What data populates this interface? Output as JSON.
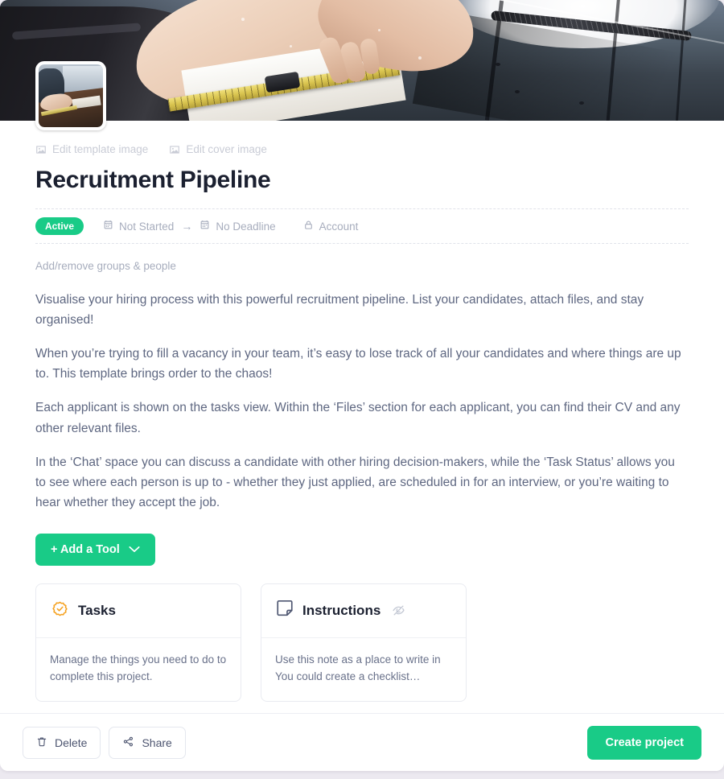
{
  "cover": {
    "alt": "Hands measuring a plank with a tape measure on a dark wooden workbench",
    "thumbnail_alt": "Person working at a workbench by a window"
  },
  "image_actions": [
    {
      "label": "Edit template image",
      "icon": "image-icon"
    },
    {
      "label": "Edit cover image",
      "icon": "image-icon"
    }
  ],
  "title": "Recruitment Pipeline",
  "meta": {
    "status_badge": "Active",
    "start_date": "Not Started",
    "arrow": "→",
    "due_date": "No Deadline",
    "visibility": "Account",
    "start_icon": "calendar-icon",
    "due_icon": "calendar-icon",
    "visibility_icon": "lock-icon"
  },
  "groups_link": "Add/remove groups & people",
  "description": [
    "Visualise your hiring process with this powerful recruitment pipeline. List your candidates, attach files, and stay organised!",
    "When you’re trying to fill a vacancy in your team, it’s easy to lose track of all your candidates and where things are up to. This template brings order to the chaos!",
    "Each applicant is shown on the tasks view. Within the ‘Files’ section for each applicant, you can find their CV and any other relevant files.",
    "In the ‘Chat’ space you can discuss a candidate with other hiring decision-makers, while the ‘Task Status’ allows you to see where each person is up to - whether they just applied, are scheduled in for an interview, or you’re waiting to hear whether they accept the job."
  ],
  "add_tool": {
    "label": "+ Add a Tool",
    "chevron_icon": "chevron-down-icon"
  },
  "tool_cards": [
    {
      "title": "Tasks",
      "icon": "task-badge-check-icon",
      "body": "Manage the things you need to do to complete this project.",
      "hidden": false
    },
    {
      "title": "Instructions",
      "icon": "note-icon",
      "body": "Use this note as a place to write in You could create a checklist…",
      "hidden": true,
      "hidden_icon": "eye-off-icon"
    }
  ],
  "footer": {
    "delete_label": "Delete",
    "delete_icon": "trash-icon",
    "share_label": "Share",
    "share_icon": "share-nodes-icon",
    "create_label": "Create project"
  },
  "colors": {
    "accent_green": "#19cb87",
    "task_orange": "#f5a11f",
    "title_text": "#1b2030",
    "body_text": "#5e6781",
    "muted_text": "#a7adbd",
    "page_bg": "#ece9f0"
  }
}
